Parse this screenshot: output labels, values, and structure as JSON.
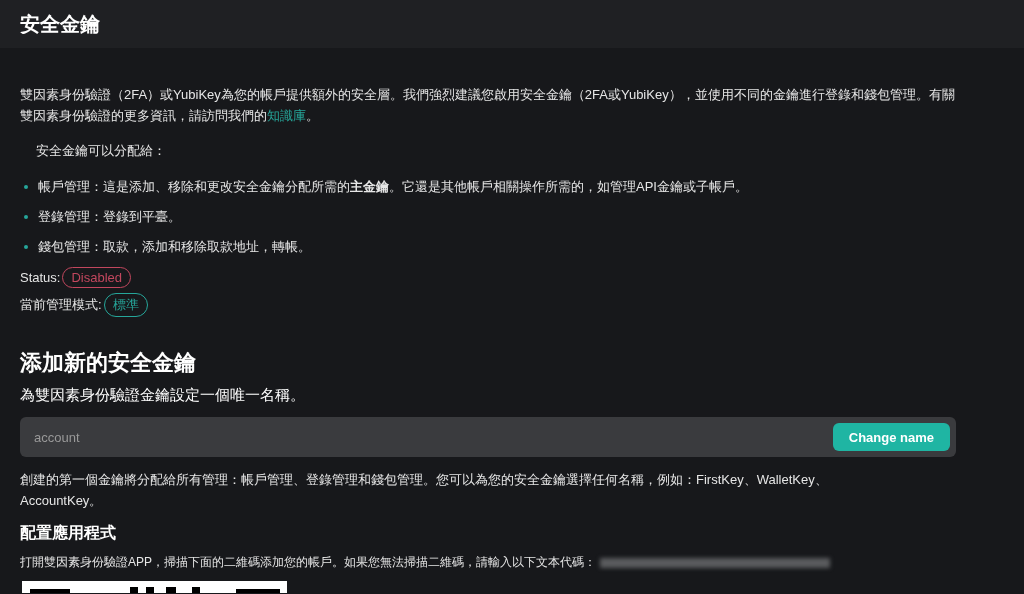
{
  "page": {
    "title": "安全金鑰"
  },
  "intro": {
    "text": "雙因素身份驗證（2FA）或YubiKey為您的帳戶提供額外的安全層。我們強烈建議您啟用安全金鑰（2FA或YubiKey），並使用不同的金鑰進行登錄和錢包管理。有關雙因素身份驗證的更多資訊，請訪問我們的",
    "link": "知識庫",
    "end": "。"
  },
  "assign_heading": "安全金鑰可以分配給：",
  "assign_items": [
    "帳戶管理：這是添加、移除和更改安全金鑰分配所需的**主金鑰**。它還是其他帳戶相關操作所需的，如管理API金鑰或子帳戶。",
    "登錄管理：登錄到平臺。",
    "錢包管理：取款，添加和移除取款地址，轉帳。"
  ],
  "status": {
    "label": "Status:",
    "value": "Disabled",
    "kind": "danger"
  },
  "mode": {
    "label": "當前管理模式:",
    "value": "標準",
    "kind": "ok"
  },
  "add_key": {
    "title": "添加新的安全金鑰",
    "subtitle": "為雙因素身份驗證金鑰設定一個唯一名稱。",
    "input_placeholder": "account",
    "button": "Change name",
    "note": "創建的第一個金鑰將分配給所有管理：帳戶管理、登錄管理和錢包管理。您可以為您的安全金鑰選擇任何名稱，例如：FirstKey、WalletKey、AccountKey。"
  },
  "configure": {
    "title": "配置應用程式",
    "text": "打開雙因素身份驗證APP，掃描下面的二維碼添加您的帳戶。如果您無法掃描二維碼，請輸入以下文本代碼："
  }
}
